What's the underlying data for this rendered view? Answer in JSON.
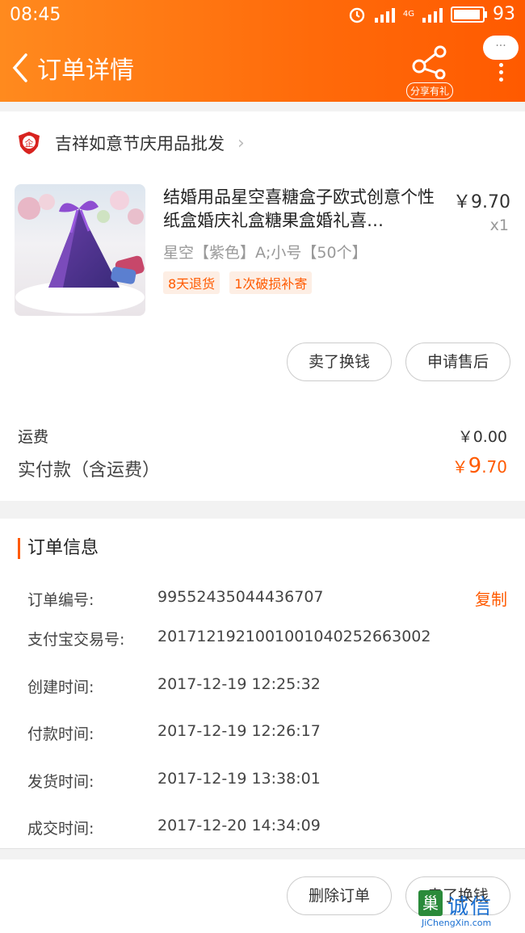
{
  "status_bar": {
    "time": "08:45",
    "network": "4G",
    "battery": "93",
    "battery_level": 0.93
  },
  "header": {
    "back_icon": "chevron-left-icon",
    "title": "订单详情",
    "share_label": "分享有礼",
    "more_bubble": "···"
  },
  "shop": {
    "name": "吉祥如意节庆用品批发",
    "badge_char": "企"
  },
  "product": {
    "name": "结婚用品星空喜糖盒子欧式创意个性纸盒婚庆礼盒糖果盒婚礼喜…",
    "price": "￥9.70",
    "quantity": "x1",
    "sku": "星空【紫色】A;小号【50个】",
    "tags": [
      "8天退货",
      "1次破损补寄"
    ]
  },
  "actions": {
    "sell_label": "卖了换钱",
    "after_sale_label": "申请售后"
  },
  "fees": {
    "shipping_label": "运费",
    "shipping_value": "￥0.00",
    "total_label": "实付款（含运费）",
    "total_currency": "￥",
    "total_int": "9",
    "total_dec": ".70"
  },
  "order_info": {
    "title": "订单信息",
    "copy_label": "复制",
    "rows": [
      {
        "label": "订单编号:",
        "value": "99552435044436707"
      },
      {
        "label": "支付宝交易号:",
        "value": "2017121921001001040252663002"
      },
      {
        "label": "创建时间:",
        "value": "2017-12-19 12:25:32"
      },
      {
        "label": "付款时间:",
        "value": "2017-12-19 12:26:17"
      },
      {
        "label": "发货时间:",
        "value": "2017-12-19 13:38:01"
      },
      {
        "label": "成交时间:",
        "value": "2017-12-20 14:34:09"
      }
    ]
  },
  "bottom": {
    "delete_label": "删除订单",
    "sell_label": "卖了换钱"
  },
  "watermark": {
    "logo_char": "巢",
    "cn": "诚信",
    "en": "JiChengXin.com"
  },
  "colors": {
    "accent": "#ff5a00",
    "header_start": "#ff8a1e"
  }
}
